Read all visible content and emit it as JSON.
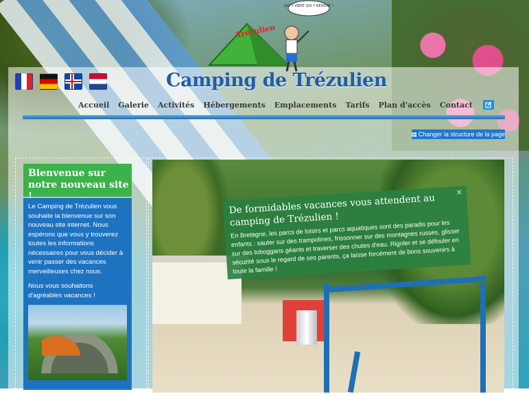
{
  "site": {
    "title": "Camping de Trézulien",
    "mascot_logo_text": "Trézulien",
    "mascot_bubble": "QUI Y VIENT QUI Y REVIENT !"
  },
  "languages": [
    "fr",
    "de",
    "is",
    "nl"
  ],
  "nav": {
    "items": [
      "Accueil",
      "Galerie",
      "Activités",
      "Hébergements",
      "Emplacements",
      "Tarifs",
      "Plan d'accès",
      "Contact"
    ],
    "edit_icon": "edit-icon"
  },
  "toolbar": {
    "structure_button": "Changer la structure de la page",
    "structure_icon": "grid-icon"
  },
  "sidebar": {
    "heading": "Bienvenue sur notre nouveau site !",
    "paragraph1": "Le Camping de Trézulien vous souhaite la bienvenue sur son nouveau site internet. Nous espérons que vous y trouverez toutes les informations nécessaires pour vous décider à venir passer des vacances merveilleuses chez nous.",
    "paragraph2": "Nous vous souhaitons d'agréables vacances !"
  },
  "slide": {
    "heading": "De formidables vacances vous attendent au camping de Trézulien !",
    "text": "En Bretagne, les parcs de loisirs et parcs aquatiques sont des paradis pour les enfants : sauter sur des trampolines, frissonner sur des montagnes russes, glisser sur des toboggans géants et traverser des chutes d'eau. Rigoler et se défouler en sécurité sous le regard de ses parents, ça laisse forcément de bons souvenirs à toute la famille !",
    "close": "×"
  },
  "colors": {
    "brand_blue": "#1f5ea8",
    "sidebar_green": "#3bb24a",
    "sidebar_blue": "#1e73c1",
    "caption_green": "#2a8040"
  }
}
